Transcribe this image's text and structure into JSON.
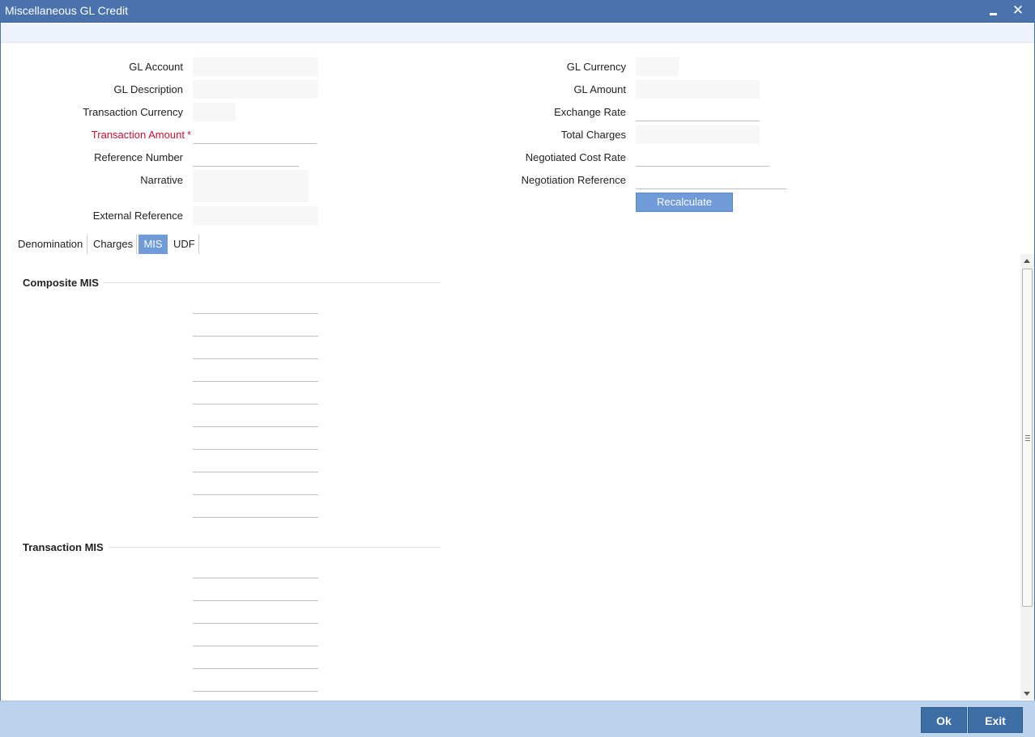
{
  "window": {
    "title": "Miscellaneous GL Credit",
    "minimize_label": "",
    "close_label": "✕"
  },
  "form": {
    "gl_account": {
      "label": "GL Account",
      "value": ""
    },
    "gl_description": {
      "label": "GL Description",
      "value": ""
    },
    "transaction_currency": {
      "label": "Transaction Currency",
      "value": ""
    },
    "transaction_amount": {
      "label": "Transaction Amount",
      "required_mark": "*",
      "value": ""
    },
    "reference_number": {
      "label": "Reference Number",
      "value": ""
    },
    "narrative": {
      "label": "Narrative",
      "value": ""
    },
    "external_reference": {
      "label": "External Reference",
      "value": ""
    },
    "gl_currency": {
      "label": "GL Currency",
      "value": ""
    },
    "gl_amount": {
      "label": "GL Amount",
      "value": ""
    },
    "exchange_rate": {
      "label": "Exchange Rate",
      "value": ""
    },
    "total_charges": {
      "label": "Total Charges",
      "value": ""
    },
    "negotiated_cost_rate": {
      "label": "Negotiated Cost Rate",
      "value": ""
    },
    "negotiation_reference": {
      "label": "Negotiation Reference",
      "value": ""
    },
    "recalculate_label": "Recalculate"
  },
  "tabs": [
    {
      "label": "Denomination",
      "active": false
    },
    {
      "label": "Charges",
      "active": false
    },
    {
      "label": "MIS",
      "active": true
    },
    {
      "label": "UDF",
      "active": false
    }
  ],
  "mis": {
    "composite_title": "Composite MIS",
    "composite_fields": [
      "",
      "",
      "",
      "",
      "",
      "",
      "",
      "",
      "",
      ""
    ],
    "transaction_title": "Transaction MIS",
    "transaction_fields": [
      "",
      "",
      "",
      "",
      "",
      ""
    ]
  },
  "footer": {
    "ok_label": "Ok",
    "exit_label": "Exit"
  },
  "colors": {
    "titlebar": "#4a73ad",
    "active_tab": "#6f9bd8",
    "required": "#c8102e",
    "footer": "#bcd3ee",
    "footer_button": "#3d6ea6"
  }
}
